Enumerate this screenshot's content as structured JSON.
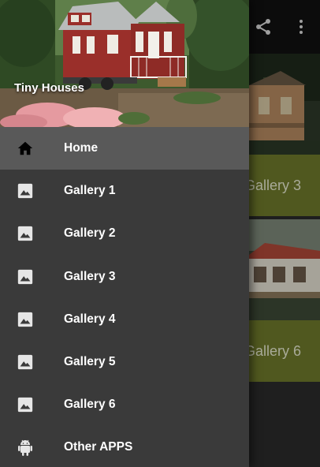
{
  "drawer": {
    "header_title": "Tiny Houses",
    "menu": [
      {
        "label": "Home",
        "icon": "home-icon",
        "active": true
      },
      {
        "label": "Gallery 1",
        "icon": "image-icon"
      },
      {
        "label": "Gallery 2",
        "icon": "image-icon"
      },
      {
        "label": "Gallery 3",
        "icon": "image-icon"
      },
      {
        "label": "Gallery 4",
        "icon": "image-icon"
      },
      {
        "label": "Gallery 5",
        "icon": "image-icon"
      },
      {
        "label": "Gallery 6",
        "icon": "image-icon"
      },
      {
        "label": "Other APPS",
        "icon": "android-icon"
      }
    ]
  },
  "background": {
    "cards": [
      {
        "caption": "Gallery 3"
      },
      {
        "caption": "Gallery 6"
      }
    ],
    "toolbar_icons": [
      "share-icon",
      "more-vert-icon"
    ]
  },
  "colors": {
    "drawer_bg": "#3a3a3a",
    "active_item_bg": "#595959",
    "card_caption_bg": "#6f7a2b",
    "toolbar_bg": "#111111"
  }
}
